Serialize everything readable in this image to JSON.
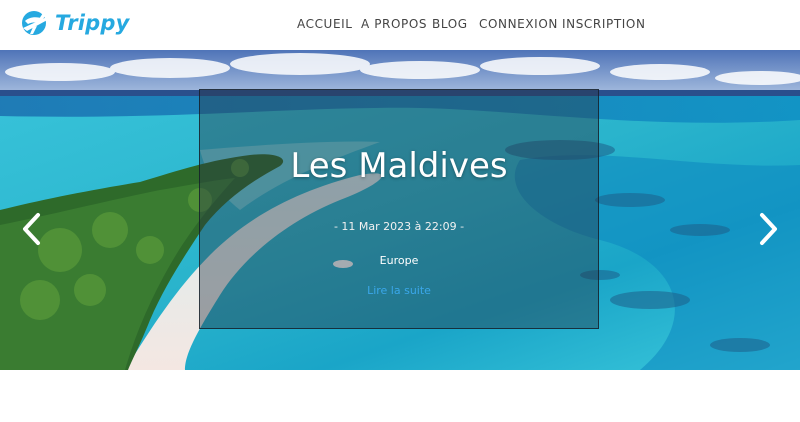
{
  "brand": {
    "name": "Trippy",
    "color": "#26a9e0"
  },
  "nav": {
    "items": [
      {
        "label": "ACCUEIL"
      },
      {
        "label": "A PROPOS"
      },
      {
        "label": "BLOG"
      },
      {
        "label": "CONNEXION"
      },
      {
        "label": "INSCRIPTION"
      }
    ]
  },
  "hero": {
    "title": "Les Maldives",
    "date": "- 11 Mar 2023 à 22:09 -",
    "region": "Europe",
    "link_label": "Lire la suite",
    "link_color": "#3aa7ea",
    "prev_icon": "chevron-left-icon",
    "next_icon": "chevron-right-icon"
  }
}
